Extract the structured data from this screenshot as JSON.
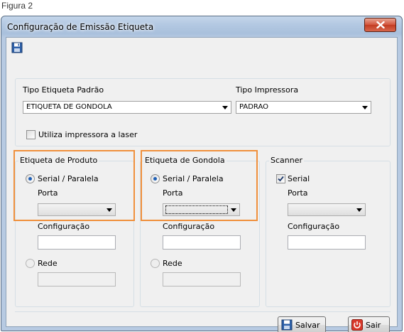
{
  "caption": "Figura 2",
  "window": {
    "title": "Configuração de Emissão Etiqueta"
  },
  "toolbar": {
    "save_icon": "save-icon"
  },
  "general": {
    "tipo_etiqueta_label": "Tipo Etiqueta Padrão",
    "tipo_etiqueta_value": "ETIQUETA DE GONDOLA",
    "tipo_impressora_label": "Tipo Impressora",
    "tipo_impressora_value": "PADRAO",
    "laser_label": "Utiliza impressora a laser",
    "laser_checked": false
  },
  "produto": {
    "title": "Etiqueta de Produto",
    "serial_label": "Serial / Paralela",
    "porta_label": "Porta",
    "porta_value": "",
    "config_label": "Configuração",
    "config_value": "",
    "rede_label": "Rede",
    "rede_value": ""
  },
  "gondola": {
    "title": "Etiqueta de Gondola",
    "serial_label": "Serial / Paralela",
    "porta_label": "Porta",
    "porta_value": "",
    "config_label": "Configuração",
    "config_value": "",
    "rede_label": "Rede",
    "rede_value": ""
  },
  "scanner": {
    "title": "Scanner",
    "serial_label": "Serial",
    "serial_checked": true,
    "porta_label": "Porta",
    "porta_value": "",
    "config_label": "Configuração",
    "config_value": ""
  },
  "buttons": {
    "save_label": "Salvar",
    "exit_label": "Sair"
  },
  "colors": {
    "highlight": "#f0903c",
    "close_button": "#c23c22"
  }
}
